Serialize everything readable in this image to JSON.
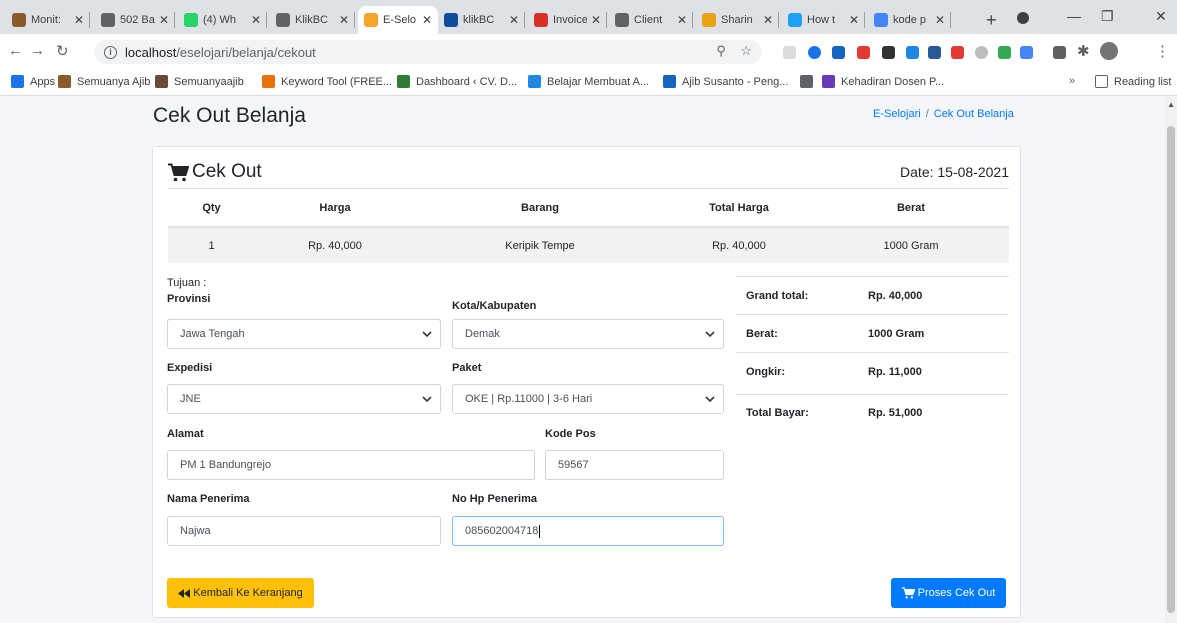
{
  "browser": {
    "tabs": [
      {
        "title": "Monit:",
        "icon": "person-favicon",
        "color": "#8b5a2b"
      },
      {
        "title": "502 Ba",
        "icon": "globe-favicon",
        "color": "#5f6368"
      },
      {
        "title": "(4) Wh",
        "icon": "whatsapp-favicon",
        "color": "#25d366"
      },
      {
        "title": "KlikBC",
        "icon": "globe-favicon",
        "color": "#5f6368"
      },
      {
        "title": "E-Selo",
        "icon": "eselojari-favicon",
        "color": "#f4a62a",
        "active": true
      },
      {
        "title": "klikBC",
        "icon": "klikbca-favicon",
        "color": "#0d4b9b"
      },
      {
        "title": "Invoice",
        "icon": "gmail-favicon",
        "color": "#d93025"
      },
      {
        "title": "Client",
        "icon": "globe-favicon",
        "color": "#5f6368"
      },
      {
        "title": "Sharin",
        "icon": "sharing-favicon",
        "color": "#e8a317"
      },
      {
        "title": "How t",
        "icon": "twitter-favicon",
        "color": "#1da1f2"
      },
      {
        "title": "kode p",
        "icon": "google-favicon",
        "color": "#4285f4"
      }
    ],
    "url_host": "localhost",
    "url_path": "/eselojari/belanja/cekout",
    "bookmarks": [
      {
        "label": "Apps",
        "icon": "apps-grid-icon",
        "color": "#1a73e8"
      },
      {
        "label": "Semuanya Ajib",
        "icon": "person-favicon",
        "color": "#8b5a2b"
      },
      {
        "label": "Semuanyaajib",
        "icon": "person-favicon",
        "color": "#6b4a3a"
      },
      {
        "label": "Keyword Tool (FREE...",
        "icon": "keyword-tool-favicon",
        "color": "#e8710a"
      },
      {
        "label": "Dashboard ‹ CV. D...",
        "icon": "dashboard-favicon",
        "color": "#2e7d32"
      },
      {
        "label": "Belajar Membuat A...",
        "icon": "belajar-favicon",
        "color": "#1e88e5"
      },
      {
        "label": "Ajib Susanto - Peng...",
        "icon": "ajib-favicon",
        "color": "#1565c0"
      },
      {
        "label": "",
        "icon": "globe-favicon",
        "color": "#5f6368"
      },
      {
        "label": "Kehadiran Dosen P...",
        "icon": "sheets-favicon",
        "color": "#673ab7"
      }
    ],
    "reading_list": "Reading list"
  },
  "page": {
    "title": "Cek Out Belanja",
    "breadcrumb": {
      "home": "E-Selojari",
      "separator": "/",
      "current": "Cek Out Belanja"
    }
  },
  "checkout": {
    "heading": "Cek Out",
    "date": "Date: 15-08-2021",
    "table": {
      "headers": [
        "Qty",
        "Harga",
        "Barang",
        "Total Harga",
        "Berat"
      ],
      "rows": [
        [
          "1",
          "Rp. 40,000",
          "Keripik Tempe",
          "Rp. 40,000",
          "1000 Gram"
        ]
      ]
    }
  },
  "form": {
    "tujuan_label": "Tujuan :",
    "provinsi": {
      "label": "Provinsi",
      "value": "Jawa Tengah"
    },
    "kota": {
      "label": "Kota/Kabupaten",
      "value": "Demak"
    },
    "expedisi": {
      "label": "Expedisi",
      "value": "JNE"
    },
    "paket": {
      "label": "Paket",
      "value": "OKE | Rp.11000 | 3-6 Hari"
    },
    "alamat": {
      "label": "Alamat",
      "value": "PM 1 Bandungrejo"
    },
    "kodepos": {
      "label": "Kode Pos",
      "value": "59567"
    },
    "nama": {
      "label": "Nama Penerima",
      "value": "Najwa"
    },
    "hp": {
      "label": "No Hp Penerima",
      "value": "085602004718"
    }
  },
  "summary": {
    "grand_total": {
      "label": "Grand total:",
      "value": "Rp. 40,000"
    },
    "berat": {
      "label": "Berat:",
      "value": "1000 Gram"
    },
    "ongkir": {
      "label": "Ongkir:",
      "value": "Rp. 11,000"
    },
    "total_bayar": {
      "label": "Total Bayar:",
      "value": "Rp. 51,000"
    }
  },
  "buttons": {
    "back": "Kembali Ke Keranjang",
    "checkout": "Proses Cek Out"
  },
  "colors": {
    "warning": "#ffc107",
    "primary": "#007bff",
    "focus_border": "#80bdff"
  }
}
